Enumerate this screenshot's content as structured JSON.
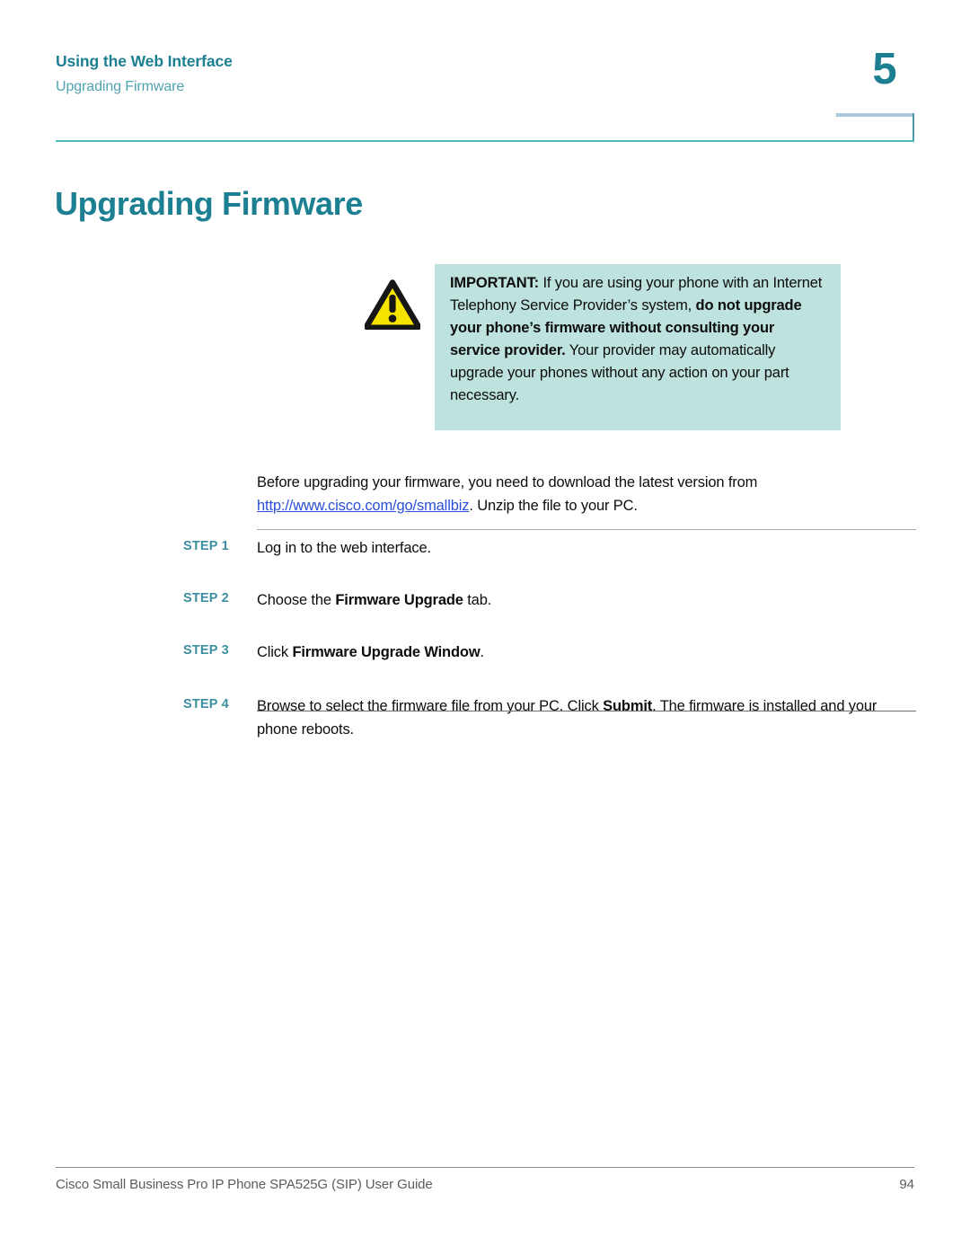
{
  "header": {
    "chapter_title": "Using the Web Interface",
    "section_title": "Upgrading Firmware",
    "chapter_number": "5"
  },
  "page_title": "Upgrading Firmware",
  "callout": {
    "icon": "warning-triangle-icon",
    "label": "IMPORTANT:",
    "text_part_1": " If you are using your phone with an Internet Telephony Service Provider’s system, ",
    "bold_part": "do not upgrade your phone’s firmware without consulting your service provider.",
    "text_part_2": " Your provider may automatically upgrade your phones without any action on your part necessary.",
    "background_color": "#bee2de"
  },
  "intro": {
    "text_before_link": "Before upgrading your firmware, you need to download the latest version from ",
    "link_text": "http://www.cisco.com/go/smallbiz",
    "text_after_link": ". Unzip the file to your PC.",
    "link_color": "#2b4fd6"
  },
  "steps": [
    {
      "label": "STEP 1",
      "text_1": "Log in to the web interface.",
      "bold": "",
      "text_2": ""
    },
    {
      "label": "STEP 2",
      "text_1": "Choose the ",
      "bold": "Firmware Upgrade",
      "text_2": " tab."
    },
    {
      "label": "STEP 3",
      "text_1": "Click ",
      "bold": "Firmware Upgrade Window",
      "text_2": "."
    },
    {
      "label": "STEP 4",
      "text_1": "Browse to select the firmware file from your PC. Click ",
      "bold": "Submit",
      "text_2": ". The firmware is installed and your phone reboots."
    }
  ],
  "footer": {
    "document_title": "Cisco Small Business Pro IP Phone SPA525G (SIP) User Guide",
    "page_number": "94"
  },
  "colors": {
    "accent_teal": "#1c7f92",
    "rule_teal": "#49bcb9",
    "step_label": "#3d8f9f",
    "warning_yellow": "#f5e400"
  }
}
